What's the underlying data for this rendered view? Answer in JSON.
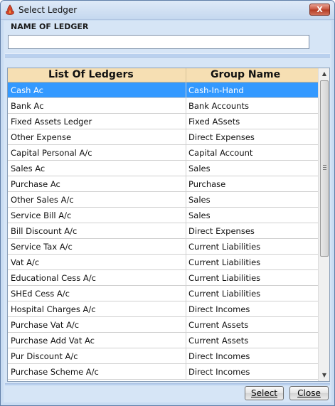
{
  "window": {
    "title": "Select Ledger",
    "close_glyph": "X"
  },
  "form": {
    "name_label": "NAME OF LEDGER",
    "name_value": ""
  },
  "grid": {
    "headers": [
      "List Of Ledgers",
      "Group Name"
    ],
    "selected_index": 0,
    "rows": [
      [
        "Cash Ac",
        "Cash-In-Hand"
      ],
      [
        "Bank Ac",
        "Bank Accounts"
      ],
      [
        "Fixed Assets Ledger",
        "Fixed ASsets"
      ],
      [
        "Other Expense",
        "Direct Expenses"
      ],
      [
        "Capital Personal A/c",
        "Capital Account"
      ],
      [
        "Sales Ac",
        "Sales"
      ],
      [
        "Purchase Ac",
        "Purchase"
      ],
      [
        "Other Sales A/c",
        "Sales"
      ],
      [
        "Service Bill A/c",
        "Sales"
      ],
      [
        "Bill Discount A/c",
        "Direct Expenses"
      ],
      [
        "Service Tax A/c",
        "Current Liabilities"
      ],
      [
        "Vat A/c",
        "Current Liabilities"
      ],
      [
        "Educational Cess A/c",
        "Current Liabilities"
      ],
      [
        "SHEd Cess A/c",
        "Current Liabilities"
      ],
      [
        "Hospital Charges A/c",
        "Direct Incomes"
      ],
      [
        "Purchase Vat A/c",
        "Current Assets"
      ],
      [
        "Purchase Add Vat Ac",
        "Current Assets"
      ],
      [
        "Pur Discount A/c",
        "Direct Incomes"
      ],
      [
        "Purchase Scheme A/c",
        "Direct Incomes"
      ]
    ]
  },
  "buttons": {
    "select": "Select",
    "close": "Close"
  },
  "icons": {
    "app": "app-flame-icon",
    "scroll_up": "scroll-up-arrow-icon",
    "scroll_down": "scroll-down-arrow-icon"
  },
  "colors": {
    "selection": "#3399ff",
    "header_bg": "#f6dfb3",
    "window_bg": "#d6e5f6"
  }
}
